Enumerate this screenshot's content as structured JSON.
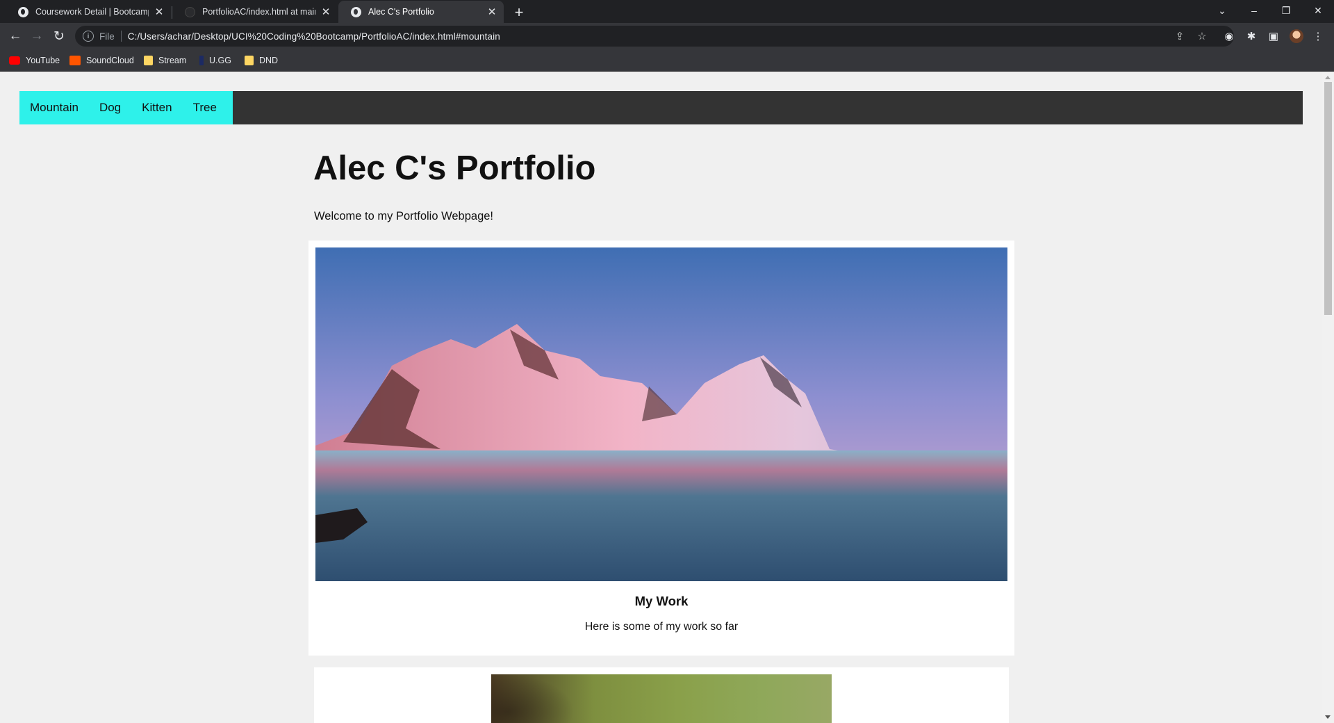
{
  "browser": {
    "tabs": [
      {
        "title": "Coursework Detail | Bootcamp Sp",
        "active": false,
        "icon": "globe-icon"
      },
      {
        "title": "PortfolioAC/index.html at main ·",
        "active": false,
        "icon": "github-icon"
      },
      {
        "title": "Alec C's Portfolio",
        "active": true,
        "icon": "globe-icon"
      }
    ],
    "omnibox": {
      "scheme": "File",
      "url": "C:/Users/achar/Desktop/UCI%20Coding%20Bootcamp/PortfolioAC/index.html#mountain"
    },
    "bookmarks": [
      {
        "label": "YouTube",
        "icon": "youtube-icon"
      },
      {
        "label": "SoundCloud",
        "icon": "soundcloud-icon"
      },
      {
        "label": "Stream",
        "icon": "folder-icon"
      },
      {
        "label": "U.GG",
        "icon": "ugg-icon"
      },
      {
        "label": "DND",
        "icon": "folder-icon"
      }
    ]
  },
  "page": {
    "nav": [
      "Mountain",
      "Dog",
      "Kitten",
      "Tree"
    ],
    "nav_color": "#2ef1ea",
    "title": "Alec C's Portfolio",
    "intro": "Welcome to my Portfolio Webpage!",
    "sections": [
      {
        "image": "mountain",
        "heading": "My Work",
        "text": "Here is some of my work so far"
      },
      {
        "image": "dog"
      }
    ]
  }
}
